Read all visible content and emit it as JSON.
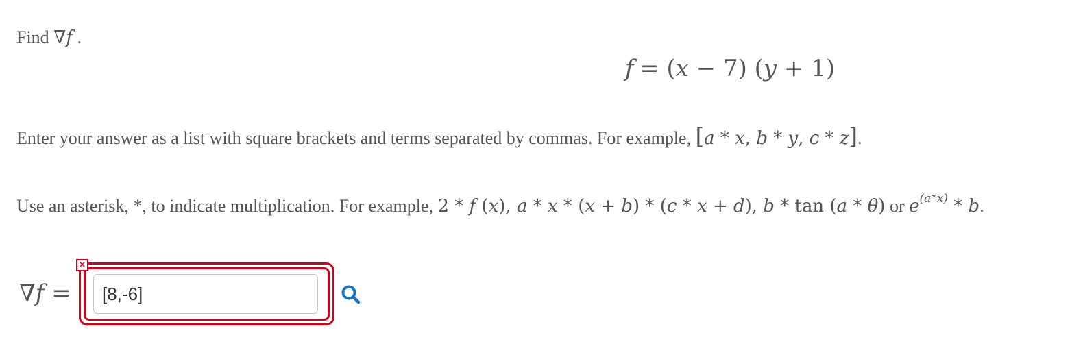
{
  "problem": {
    "prompt_word": "Find",
    "prompt_symbol": "∇",
    "prompt_var": "f",
    "prompt_end": "."
  },
  "equation": {
    "lhs": "f",
    "rhs_1": "= (",
    "x": "x",
    "rhs_2": " − 7) (",
    "y": "y",
    "rhs_3": " + 1)"
  },
  "instruction1": {
    "text": "Enter your answer as a list with square brackets and terms separated by commas. For example, ",
    "ob": "[",
    "a": "a",
    "s1": " * ",
    "x": "x",
    "c1": ",  ",
    "b": "b",
    "s2": " * ",
    "y": "y",
    "c2": ",  ",
    "c": "c",
    "s3": " * ",
    "z": "z",
    "cb": "]",
    "end": "."
  },
  "instruction2": {
    "text": "Use an asterisk, *, to indicate multiplication. For example, ",
    "e1_num": "2",
    "e1_op": " * ",
    "e1_f": "f",
    "e1_open": " (",
    "e1_x": "x",
    "e1_close": ")",
    "sep1": ", ",
    "e2_a": "a",
    "e2_op1": " * ",
    "e2_x1": "x",
    "e2_op2": " * (",
    "e2_x2": "x",
    "e2_plus1": " + ",
    "e2_b": "b",
    "e2_op3": ") * (",
    "e2_c": "c",
    "e2_op4": " * ",
    "e2_x3": "x",
    "e2_plus2": " + ",
    "e2_d": "d",
    "e2_close": ")",
    "sep2": ", ",
    "e3_b": "b",
    "e3_op1": " * tan (",
    "e3_a": "a",
    "e3_op2": " * ",
    "e3_theta": "θ",
    "e3_close": ")",
    "or_word": " or ",
    "e4_e": "e",
    "e4_sup": "(a*x)",
    "e4_op": " * ",
    "e4_b": "b",
    "end": "."
  },
  "answer": {
    "label_symbol": "∇",
    "label_var": "f",
    "label_eq": " =",
    "value": "[8,-6]",
    "error_glyph": "×"
  },
  "icons": {
    "preview": "magnifier-icon",
    "error": "close-icon"
  },
  "colors": {
    "text": "#555555",
    "error": "#d0021b",
    "link": "#1a73c8"
  }
}
